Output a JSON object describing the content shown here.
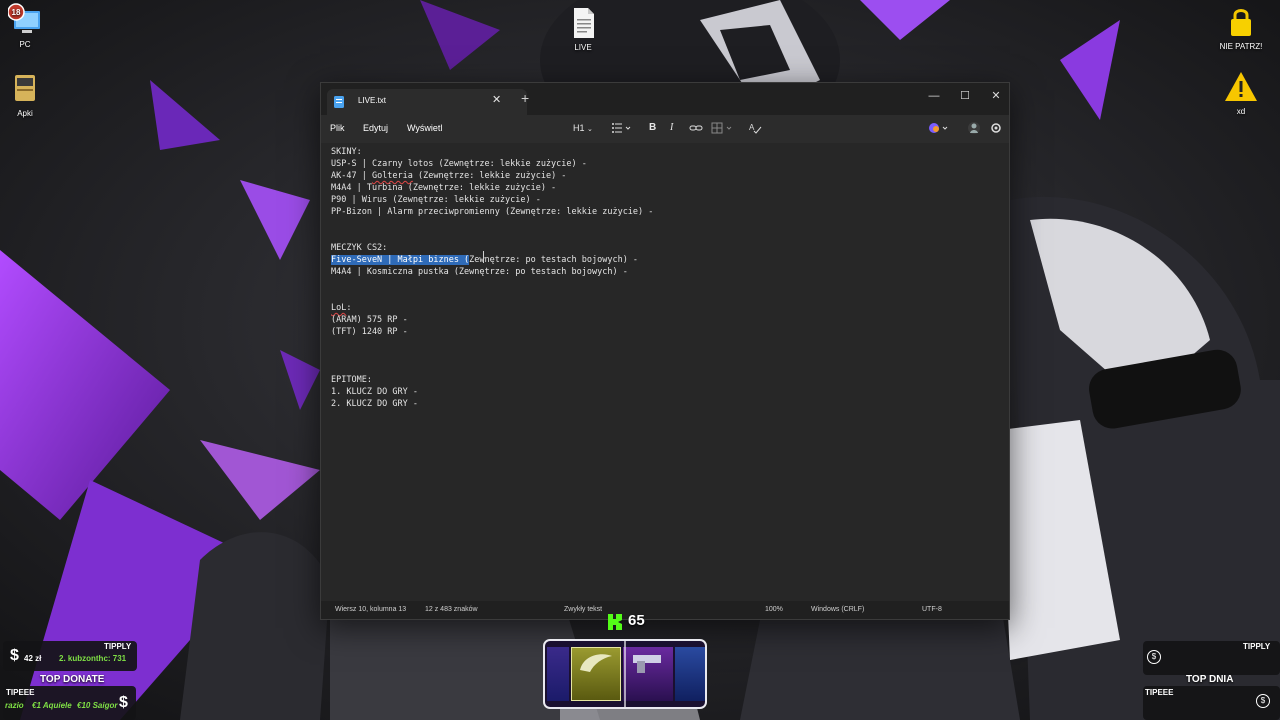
{
  "desktop": {
    "icons": [
      {
        "label": "PC",
        "icon": "pc-icon"
      },
      {
        "label": "Apki",
        "icon": "apps-icon"
      },
      {
        "label": "LIVE",
        "icon": "text-file-icon"
      },
      {
        "label": "NIE PATRZ!",
        "icon": "padlock-icon"
      },
      {
        "label": "xd",
        "icon": "warning-icon"
      }
    ]
  },
  "notepad": {
    "tab_title": "LIVE.txt",
    "menu": [
      "Plik",
      "Edytuj",
      "Wyświetl"
    ],
    "heading_select": "H1",
    "document": {
      "lines": [
        "SKINY:",
        "USP-S | Czarny lotos (Zewnętrze: lekkie zużycie) -",
        "AK-47 | Golteria (Zewnętrze: lekkie zużycie) -",
        "M4A4 | Turbina (Zewnętrze: lekkie zużycie) -",
        "P90 | Wirus (Zewnętrze: lekkie zużycie) -",
        "PP-Bizon | Alarm przeciwpromienny (Zewnętrze: lekkie zużycie) -",
        "",
        "",
        "MECZYK CS2:",
        "Five-SeveN | Małpi biznes (Zewnętrze: po testach bojowych) -",
        "M4A4 | Kosmiczna pustka (Zewnętrze: po testach bojowych) -",
        "",
        "",
        "LoL:",
        "(ARAM) 575 RP -",
        "(TFT) 1240 RP -",
        "",
        "",
        "",
        "EPITOME:",
        "1. KLUCZ DO GRY -",
        "2. KLUCZ DO GRY -"
      ],
      "selected_text": "Five-SeveN | Małpi biznes (",
      "misspelled": [
        "Golteria",
        "LoL"
      ]
    },
    "status": {
      "position": "Wiersz 10, kolumna 13",
      "selection": "12 z 483 znaków",
      "format": "Zwykły tekst",
      "zoom": "100%",
      "line_ending": "Windows (CRLF)",
      "encoding": "UTF-8"
    }
  },
  "overlays": {
    "tipply_left": {
      "brand": "TIPPLY",
      "amount": "42 zł",
      "rank_text": "2. kubzonthc: 731"
    },
    "top_donate_label": "TOP DONATE",
    "tipeee_left": {
      "brand": "TIPEEE",
      "entries": [
        "razio",
        "€1 Aquiele",
        "€10 Saigor"
      ]
    },
    "kick_counter": "65",
    "tipply_right": {
      "brand": "TIPPLY",
      "top_label": "TOP DNIA",
      "tipeee": "TIPEEE"
    }
  },
  "colors": {
    "accent_purple": "#8a2be2",
    "selection_blue": "#2f6bb8",
    "kick_green": "#53fc18"
  }
}
